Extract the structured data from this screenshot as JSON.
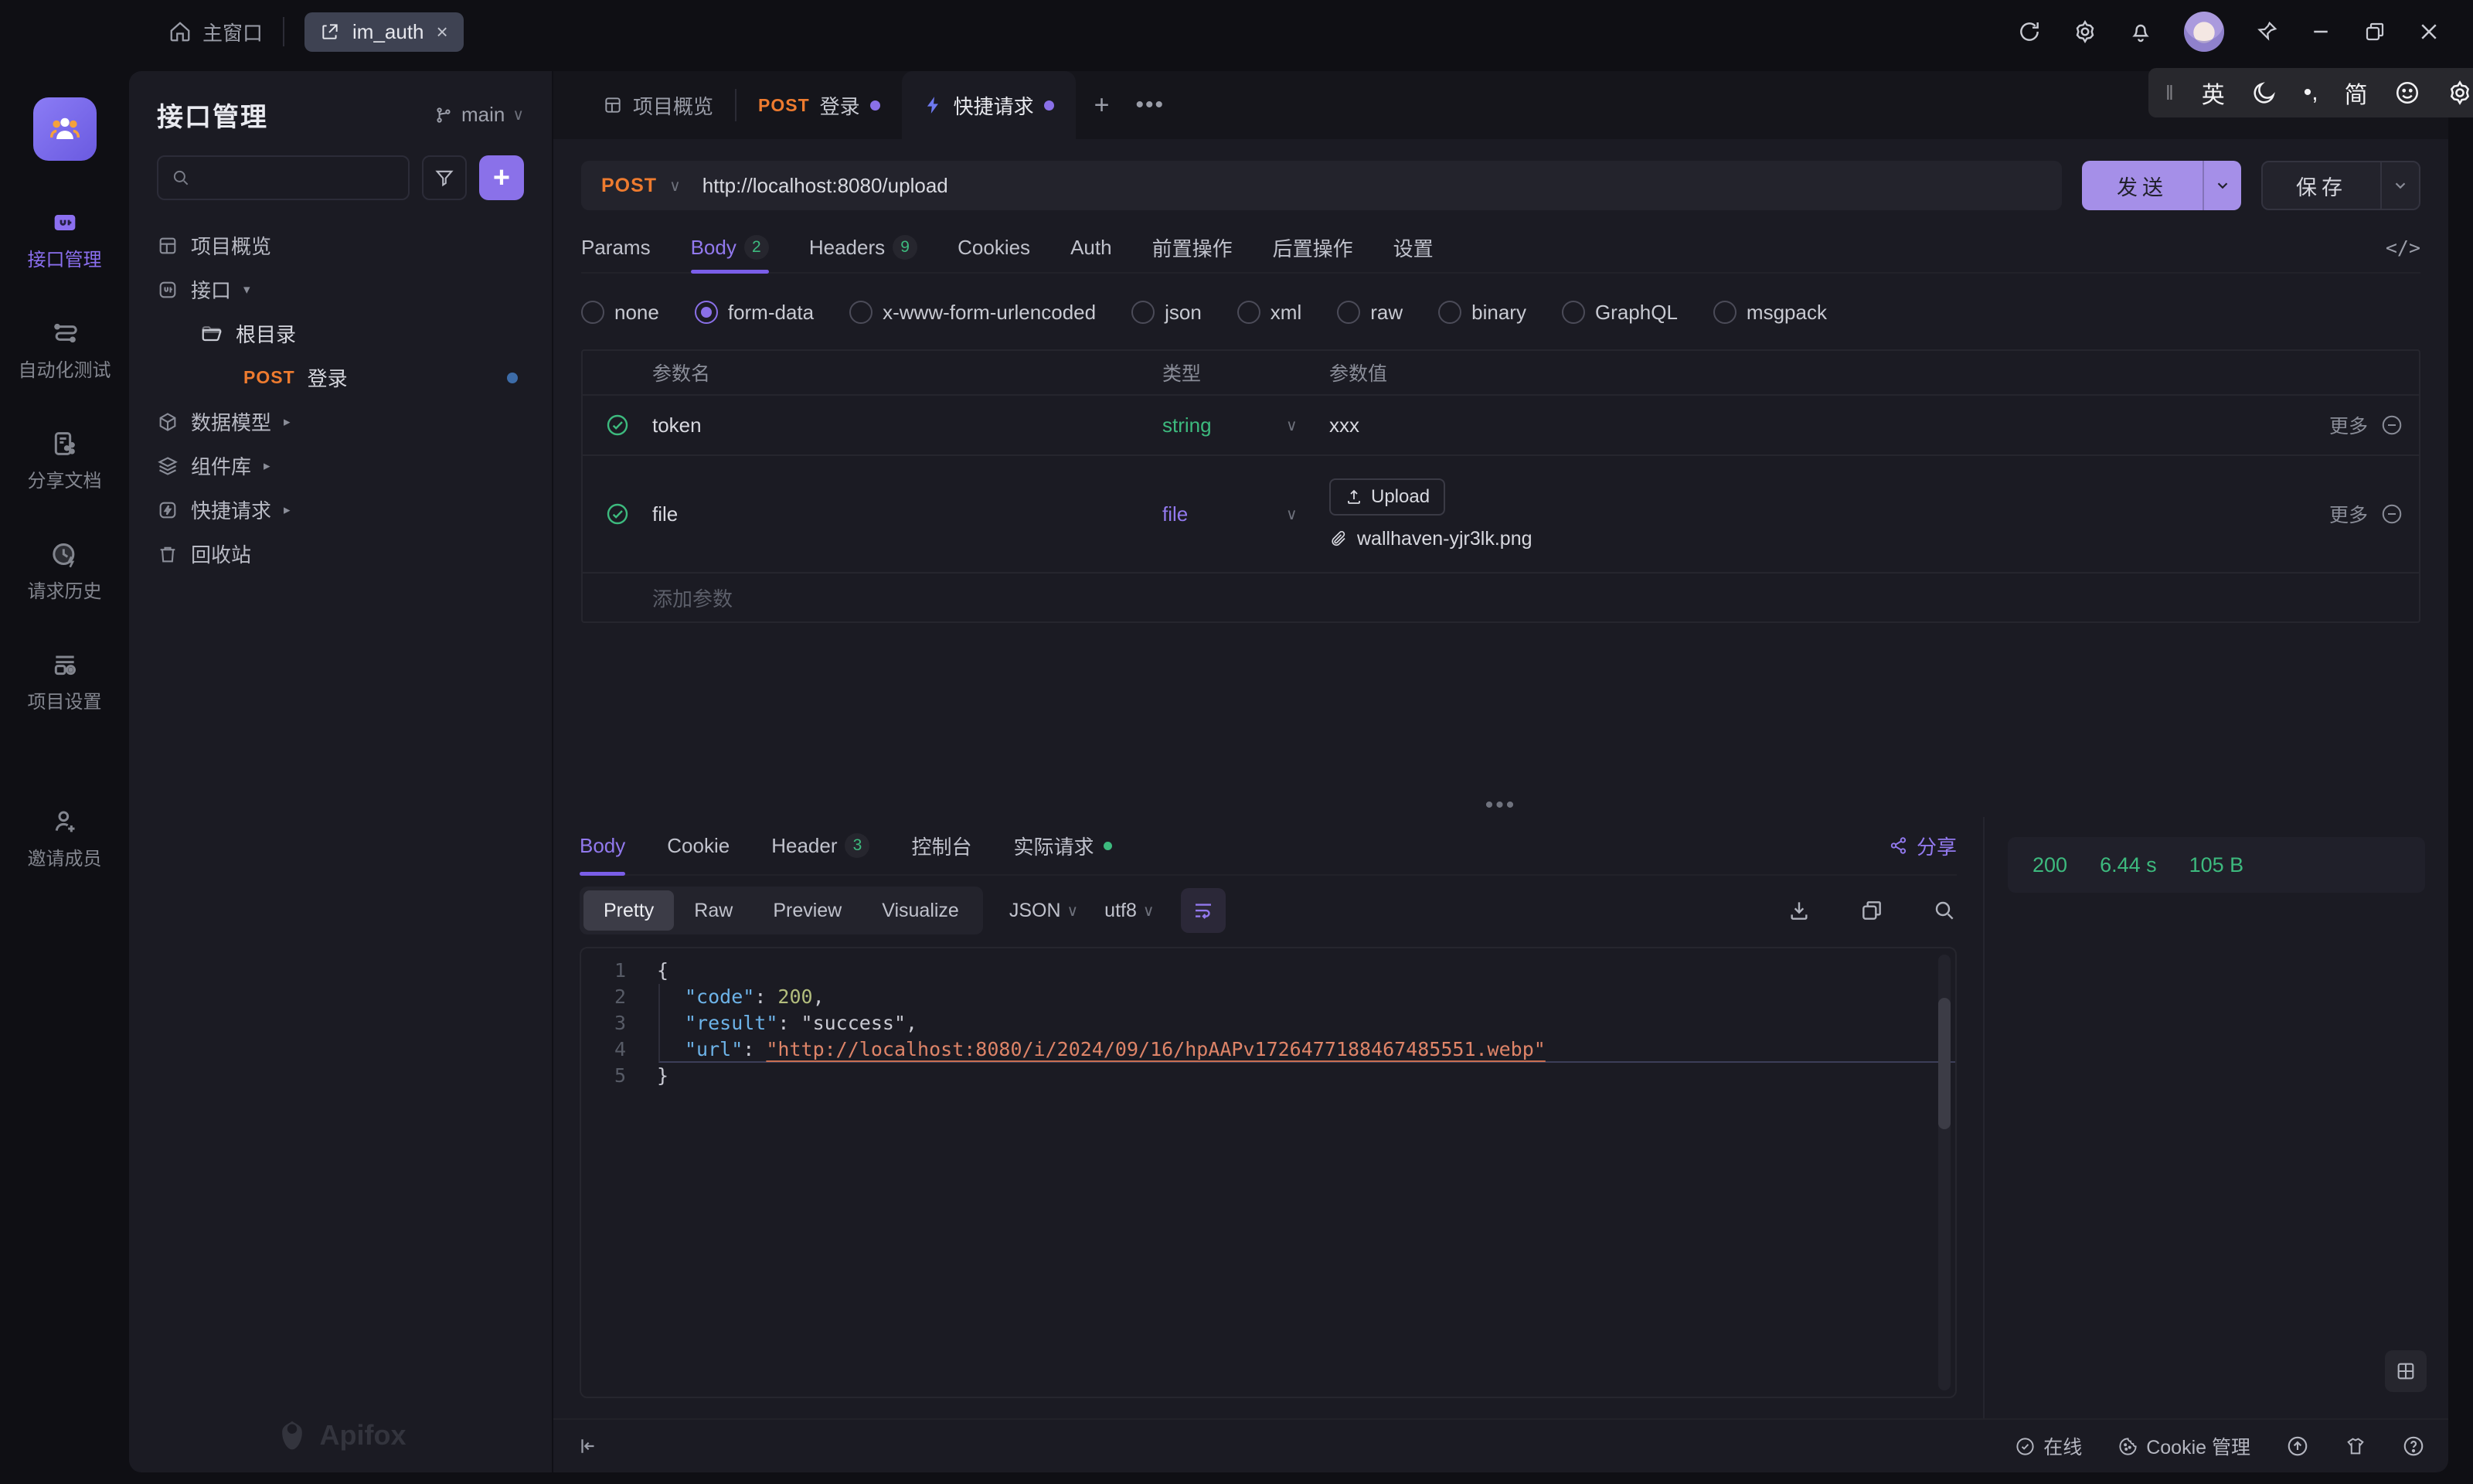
{
  "titlebar": {
    "home_label": "主窗口",
    "project_tab_label": "im_auth"
  },
  "ime_bar": {
    "english_indicator": "英",
    "punctuation_indicator": "•,",
    "simplified_indicator": "简"
  },
  "rail": {
    "items": [
      {
        "label": "接口管理"
      },
      {
        "label": "自动化测试"
      },
      {
        "label": "分享文档"
      },
      {
        "label": "请求历史"
      },
      {
        "label": "项目设置"
      },
      {
        "label": "邀请成员"
      }
    ]
  },
  "sidebar": {
    "title": "接口管理",
    "branch_label": "main",
    "tree": {
      "project_overview": "项目概览",
      "interfaces": "接口",
      "root_dir": "根目录",
      "login_method": "POST",
      "login_label": "登录",
      "data_models": "数据模型",
      "components": "组件库",
      "quick_request": "快捷请求",
      "recycle_bin": "回收站"
    },
    "brand": "Apifox"
  },
  "doc_tabs": {
    "overview": "项目概览",
    "login_method": "POST",
    "login_label": "登录",
    "quick_request": "快捷请求"
  },
  "request": {
    "method": "POST",
    "url": "http://localhost:8080/upload",
    "send_label": "发送",
    "save_label": "保存",
    "tabs": [
      {
        "label": "Params"
      },
      {
        "label": "Body",
        "badge": "2"
      },
      {
        "label": "Headers",
        "badge": "9"
      },
      {
        "label": "Cookies"
      },
      {
        "label": "Auth"
      },
      {
        "label": "前置操作"
      },
      {
        "label": "后置操作"
      },
      {
        "label": "设置"
      }
    ],
    "body_types": [
      "none",
      "form-data",
      "x-www-form-urlencoded",
      "json",
      "xml",
      "raw",
      "binary",
      "GraphQL",
      "msgpack"
    ],
    "selected_body_type": "form-data",
    "params_table": {
      "headers": {
        "name": "参数名",
        "type": "类型",
        "value": "参数值"
      },
      "rows": [
        {
          "name": "token",
          "type": "string",
          "value": "xxx",
          "more": "更多"
        },
        {
          "name": "file",
          "type": "file",
          "upload_label": "Upload",
          "file_name": "wallhaven-yjr3lk.png",
          "more": "更多"
        }
      ],
      "add_row_label": "添加参数"
    }
  },
  "response": {
    "tabs": {
      "body": "Body",
      "cookie": "Cookie",
      "header": "Header",
      "header_badge": "3",
      "console": "控制台",
      "actual_request": "实际请求"
    },
    "share_label": "分享",
    "status": {
      "code": "200",
      "time": "6.44 s",
      "size": "105 B"
    },
    "view_modes": [
      "Pretty",
      "Raw",
      "Preview",
      "Visualize"
    ],
    "active_view_mode": "Pretty",
    "format_select": "JSON",
    "encoding_select": "utf8",
    "body_json": {
      "line_numbers": [
        "1",
        "2",
        "3",
        "4",
        "5"
      ],
      "lines": {
        "l1": "{",
        "l2_key": "\"code\"",
        "l2_sep": ": ",
        "l2_value": "200",
        "l2_comma": ",",
        "l3_key": "\"result\"",
        "l3_sep": ": ",
        "l3_value": "\"success\"",
        "l3_comma": ",",
        "l4_key": "\"url\"",
        "l4_sep": ": ",
        "l4_value": "\"http://localhost:8080/i/2024/09/16/hpAAPv1726477188467485551.webp\"",
        "l5": "}"
      }
    }
  },
  "footer": {
    "online_label": "在线",
    "cookie_label": "Cookie 管理"
  },
  "colors": {
    "accent_purple": "#8A70E8",
    "method_orange": "#EE7B2F",
    "success_green": "#3DBA7E",
    "unsaved_blue_dot": "#3D6CA8",
    "code_key": "#6DB3E8",
    "code_number": "#B3BD7D",
    "code_link": "#DE8468"
  }
}
